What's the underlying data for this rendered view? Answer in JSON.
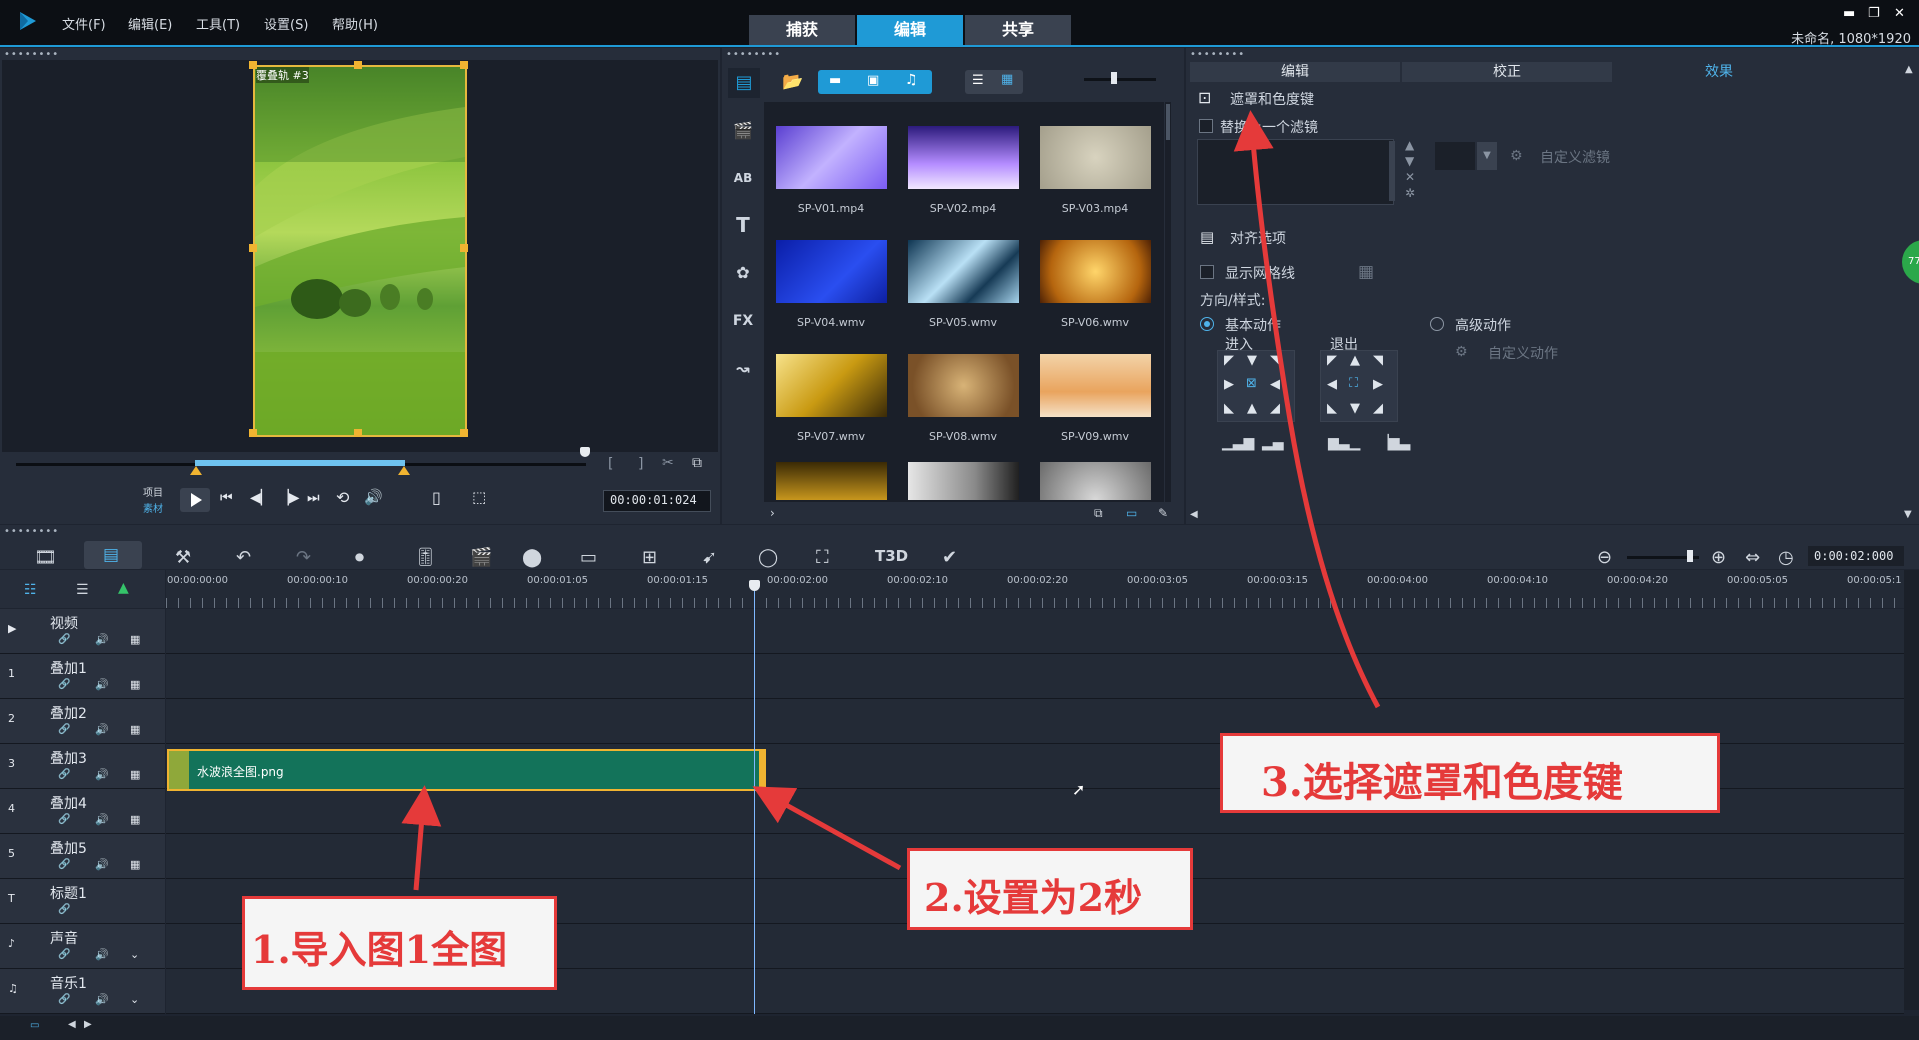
{
  "menu": {
    "file": "文件(F)",
    "edit": "编辑(E)",
    "tools": "工具(T)",
    "settings": "设置(S)",
    "help": "帮助(H)"
  },
  "main_tabs": {
    "capture": "捕获",
    "edit": "编辑",
    "share": "共享"
  },
  "project_info": "未命名, 1080*1920",
  "preview": {
    "track_label": "覆叠轨 #3",
    "mode_project": "项目",
    "mode_clip": "素材",
    "timecode": "00:00:01:024"
  },
  "library": {
    "items": [
      {
        "name": "SP-V01.mp4"
      },
      {
        "name": "SP-V02.mp4"
      },
      {
        "name": "SP-V03.mp4"
      },
      {
        "name": "SP-V04.wmv"
      },
      {
        "name": "SP-V05.wmv"
      },
      {
        "name": "SP-V06.wmv"
      },
      {
        "name": "SP-V07.wmv"
      },
      {
        "name": "SP-V08.wmv"
      },
      {
        "name": "SP-V09.wmv"
      }
    ]
  },
  "options": {
    "tabs": {
      "edit": "编辑",
      "correct": "校正",
      "effect": "效果"
    },
    "mask_chroma": "遮罩和色度键",
    "replace_filter": "替换上一个滤镜",
    "custom_filter": "自定义滤镜",
    "align_options": "对齐选项",
    "show_grid": "显示网格线",
    "direction_style": "方向/样式:",
    "basic_motion": "基本动作",
    "advanced_motion": "高级动作",
    "enter": "进入",
    "exit": "退出",
    "custom_motion": "自定义动作"
  },
  "timeline": {
    "total_time": "0:00:02:000",
    "ruler": [
      "00:00:00:00",
      "00:00:00:10",
      "00:00:00:20",
      "00:00:01:05",
      "00:00:01:15",
      "00:00:02:00",
      "00:00:02:10",
      "00:00:02:20",
      "00:00:03:05",
      "00:00:03:15",
      "00:00:04:00",
      "00:00:04:10",
      "00:00:04:20",
      "00:00:05:05",
      "00:00:05:1"
    ],
    "tracks": [
      {
        "badge": "▶",
        "name": "视频"
      },
      {
        "badge": "1",
        "name": "叠加1"
      },
      {
        "badge": "2",
        "name": "叠加2"
      },
      {
        "badge": "3",
        "name": "叠加3"
      },
      {
        "badge": "4",
        "name": "叠加4"
      },
      {
        "badge": "5",
        "name": "叠加5"
      },
      {
        "badge": "T",
        "name": "标题1"
      },
      {
        "badge": "♪",
        "name": "声音"
      },
      {
        "badge": "♫",
        "name": "音乐1"
      }
    ],
    "clip_name": "水波浪全图.png"
  },
  "annotations": {
    "step1": "1.导入图1全图",
    "step2": "2.设置为2秒",
    "step3": "3.选择遮罩和色度键"
  },
  "colors": {
    "accent": "#1f9ad6",
    "clip": "#13735a",
    "annotation": "#e53a3a"
  }
}
